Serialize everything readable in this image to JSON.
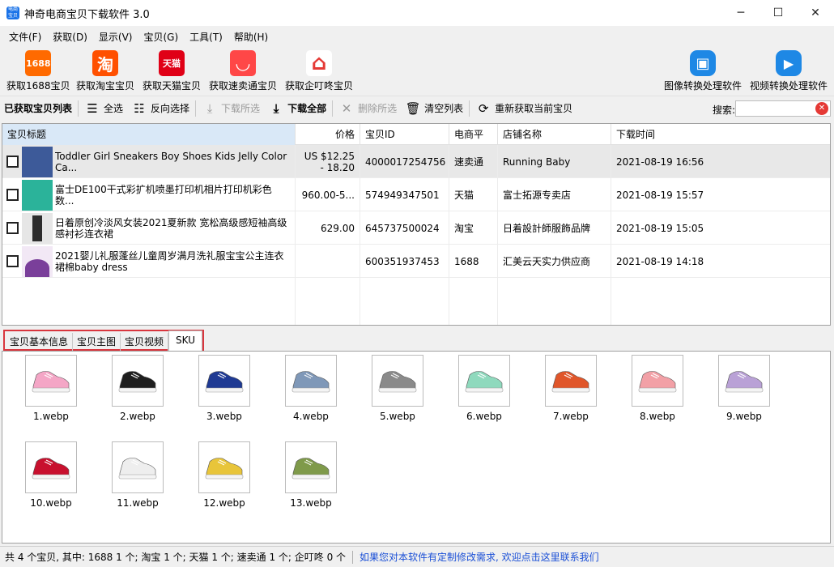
{
  "window": {
    "title": "神奇电商宝贝下载软件 3.0",
    "minimize": "─",
    "maximize": "☐",
    "close": "✕",
    "app_icon_text": "电商宝贝"
  },
  "menu": [
    "文件(F)",
    "获取(D)",
    "显示(V)",
    "宝贝(G)",
    "工具(T)",
    "帮助(H)"
  ],
  "big_toolbar": [
    {
      "label": "获取1688宝贝",
      "icon": "1688-icon",
      "glyph": "1688",
      "color": "#ff6a00"
    },
    {
      "label": "获取淘宝宝贝",
      "icon": "taobao-icon",
      "glyph": "淘",
      "color": "#ff5000"
    },
    {
      "label": "获取天猫宝贝",
      "icon": "tmall-icon",
      "glyph": "天猫",
      "color": "#e00016"
    },
    {
      "label": "获取速卖通宝贝",
      "icon": "aliexpress-icon",
      "glyph": "◡",
      "color": "#ff4747"
    },
    {
      "label": "获取企叮咚宝贝",
      "icon": "qidingdong-icon",
      "glyph": "⌂",
      "color": "#e53935"
    },
    {
      "label": "图像转换处理软件",
      "icon": "image-convert-icon",
      "glyph": "▣",
      "color": "#1e88e5"
    },
    {
      "label": "视频转换处理软件",
      "icon": "video-convert-icon",
      "glyph": "▶",
      "color": "#1e88e5"
    }
  ],
  "small_toolbar": {
    "list_label": "已获取宝贝列表",
    "select_all": "全选",
    "invert_select": "反向选择",
    "download_selected": "下载所选",
    "download_all": "下载全部",
    "delete_selected": "删除所选",
    "clear_list": "清空列表",
    "refetch": "重新获取当前宝贝",
    "search_label": "搜索:",
    "search_value": ""
  },
  "table": {
    "columns": [
      "宝贝标题",
      "价格",
      "宝贝ID",
      "电商平台",
      "店铺名称",
      "下载时间"
    ],
    "rows": [
      {
        "title": "Toddler Girl Sneakers Boy Shoes Kids Jelly Color Ca...",
        "price": "US $12.25 - 18.20",
        "id": "4000017254756",
        "platform": "速卖通",
        "shop": "Running Baby",
        "time": "2021-08-19 16:56",
        "thumb_color": "#3d5a99"
      },
      {
        "title": "富士DE100干式彩扩机喷墨打印机相片打印机彩色数...",
        "price": "960.00-5...",
        "id": "574949347501",
        "platform": "天猫",
        "shop": "富士拓源专卖店",
        "time": "2021-08-19 15:57",
        "thumb_color": "#2bb39a"
      },
      {
        "title": "日着原创冷淡风女装2021夏新款 宽松高级感短袖高级感衬衫连衣裙",
        "price": "629.00",
        "id": "645737500024",
        "platform": "淘宝",
        "shop": "日着設計師服飾品牌",
        "time": "2021-08-19 15:05",
        "thumb_color": "#2d2d2d"
      },
      {
        "title": "2021婴儿礼服蓬丝儿童周岁满月洗礼服宝宝公主连衣裙棉baby dress",
        "price": "",
        "id": "600351937453",
        "platform": "1688",
        "shop": "汇美云天实力供应商",
        "time": "2021-08-19 14:18",
        "thumb_color": "#7a3f9a"
      }
    ]
  },
  "tabs": [
    "宝贝基本信息",
    "宝贝主图",
    "宝贝视频",
    "SKU"
  ],
  "sku_images": [
    {
      "name": "1.webp",
      "color": "#f4a6c6"
    },
    {
      "name": "2.webp",
      "color": "#1e1e1e"
    },
    {
      "name": "3.webp",
      "color": "#1f3a93"
    },
    {
      "name": "4.webp",
      "color": "#7f98b8"
    },
    {
      "name": "5.webp",
      "color": "#8a8a8a"
    },
    {
      "name": "6.webp",
      "color": "#8fd9bd"
    },
    {
      "name": "7.webp",
      "color": "#e0562a"
    },
    {
      "name": "8.webp",
      "color": "#f2a0a6"
    },
    {
      "name": "9.webp",
      "color": "#b9a1d6"
    },
    {
      "name": "10.webp",
      "color": "#c8102e"
    },
    {
      "name": "11.webp",
      "color": "#eeeeee"
    },
    {
      "name": "12.webp",
      "color": "#e8c53a"
    },
    {
      "name": "13.webp",
      "color": "#7f9a4a"
    }
  ],
  "status": {
    "summary": "共 4 个宝贝, 其中: 1688 1 个; 淘宝 1 个; 天猫 1 个; 速卖通 1 个; 企叮咚 0 个",
    "link": "如果您对本软件有定制修改需求, 欢迎点击这里联系我们"
  }
}
